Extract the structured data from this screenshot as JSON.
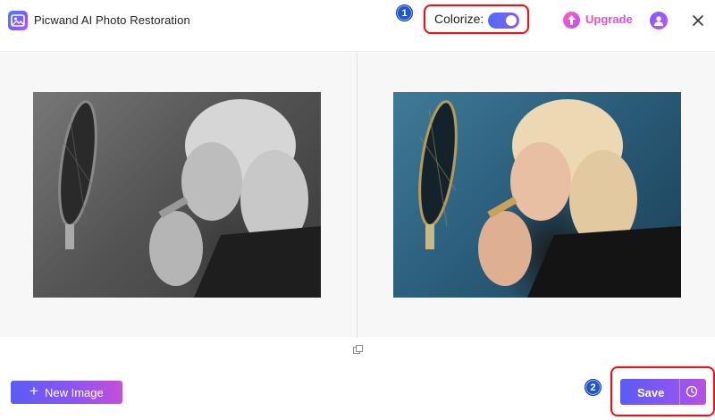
{
  "app": {
    "title": "Picwand AI Photo Restoration"
  },
  "header": {
    "colorize_label": "Colorize:",
    "colorize_enabled": true,
    "upgrade_label": "Upgrade"
  },
  "annotations": {
    "step1": "1",
    "step2": "2"
  },
  "footer": {
    "new_image_label": "New Image",
    "save_label": "Save"
  },
  "icons": {
    "logo": "app-logo-icon",
    "upgrade": "upgrade-arrow-icon",
    "user": "user-icon",
    "close": "close-icon",
    "compare": "compare-icon",
    "history": "clock-icon"
  },
  "colors": {
    "accent_start": "#5b5cf5",
    "accent_end": "#c54fd9",
    "annotation_red": "#e0161d",
    "badge_blue": "#1f56c8"
  }
}
